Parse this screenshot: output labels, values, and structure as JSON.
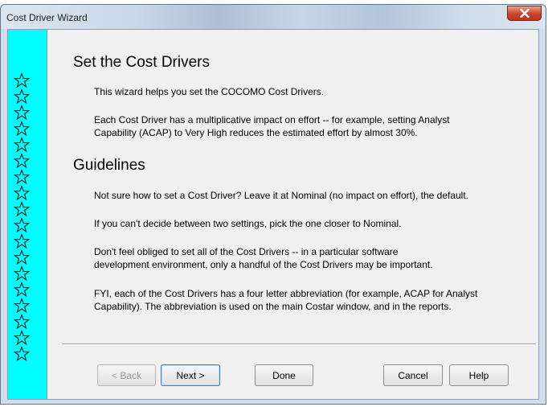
{
  "window": {
    "title": "Cost Driver Wizard"
  },
  "content": {
    "heading1": "Set the Cost Drivers",
    "intro": "This wizard helps you set the COCOMO Cost Drivers.",
    "impact_line1": "Each Cost Driver has a multiplicative impact on effort -- for example, setting Analyst",
    "impact_line2": "Capability (ACAP) to Very High reduces the estimated effort by almost 30%.",
    "heading2": "Guidelines",
    "guide1": "Not sure how to set a Cost Driver?  Leave it at Nominal (no impact on effort), the default.",
    "guide2": "If you can't decide between two settings, pick the one closer to Nominal.",
    "guide3_line1": "Don't feel obliged to set all of the Cost Drivers -- in a particular software",
    "guide3_line2": "development environment, only a handful of the Cost Drivers may be important.",
    "guide4_line1": "FYI, each of the Cost Drivers has a four letter abbreviation (for example, ACAP for Analyst",
    "guide4_line2": "Capability).  The abbreviation is used on the main Costar window, and in the reports."
  },
  "buttons": {
    "back": "< Back",
    "next": "Next >",
    "done": "Done",
    "cancel": "Cancel",
    "help": "Help"
  },
  "decoration": {
    "star_icon": "star-outline-icon",
    "star_strip_color": "#00ffff",
    "star_count": 18
  }
}
